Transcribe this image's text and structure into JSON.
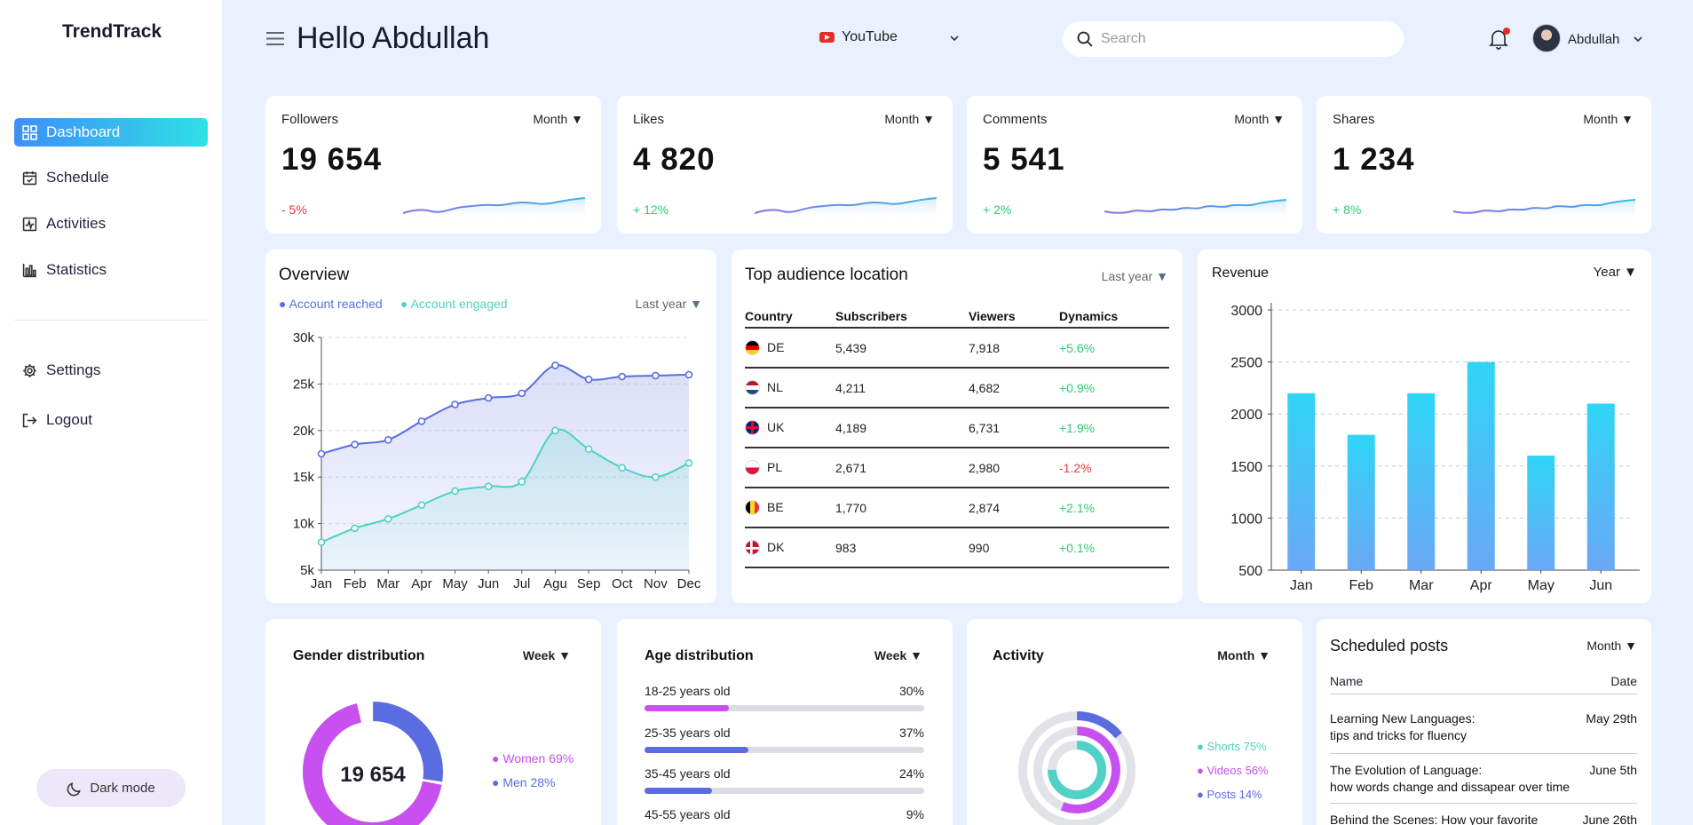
{
  "app": {
    "logo": "TrendTrack"
  },
  "sidebar": {
    "items": [
      {
        "label": "Dashboard",
        "icon": "grid-icon"
      },
      {
        "label": "Schedule",
        "icon": "calendar-icon"
      },
      {
        "label": "Activities",
        "icon": "activity-icon"
      },
      {
        "label": "Statistics",
        "icon": "bar-chart-icon"
      },
      {
        "label": "Settings",
        "icon": "gear-icon"
      },
      {
        "label": "Logout",
        "icon": "logout-icon"
      }
    ],
    "dark_mode_label": "Dark mode"
  },
  "header": {
    "greeting": "Hello Abdullah",
    "platform": "YouTube",
    "search_placeholder": "Search",
    "user_name": "Abdullah"
  },
  "stats": [
    {
      "title": "Followers",
      "period": "Month ▼",
      "value": "19 654",
      "change": "- 5%",
      "change_color": "#e53935"
    },
    {
      "title": "Likes",
      "period": "Month ▼",
      "value": "4 820",
      "change": "+ 12%",
      "change_color": "#2ecc71"
    },
    {
      "title": "Comments",
      "period": "Month ▼",
      "value": "5 541",
      "change": "+ 2%",
      "change_color": "#2ecc71"
    },
    {
      "title": "Shares",
      "period": "Month ▼",
      "value": "1 234",
      "change": "+ 8%",
      "change_color": "#2ecc71"
    }
  ],
  "overview": {
    "title": "Overview",
    "period": "Last year",
    "legend_reached": "● Account reached",
    "legend_engaged": "● Account engaged"
  },
  "location": {
    "title": "Top audience location",
    "period": "Last year",
    "headers": [
      "Country",
      "Subscribers",
      "Viewers",
      "Dynamics"
    ],
    "rows": [
      {
        "code": "DE",
        "subs": "5,439",
        "views": "7,918",
        "dyn": "+5.6%",
        "up": true
      },
      {
        "code": "NL",
        "subs": "4,211",
        "views": "4,682",
        "dyn": "+0.9%",
        "up": true
      },
      {
        "code": "UK",
        "subs": "4,189",
        "views": "6,731",
        "dyn": "+1.9%",
        "up": true
      },
      {
        "code": "PL",
        "subs": "2,671",
        "views": "2,980",
        "dyn": "-1.2%",
        "up": false
      },
      {
        "code": "BE",
        "subs": "1,770",
        "views": "2,874",
        "dyn": "+2.1%",
        "up": true
      },
      {
        "code": "DK",
        "subs": "983",
        "views": "990",
        "dyn": "+0.1%",
        "up": true
      }
    ]
  },
  "revenue": {
    "title": "Revenue",
    "period": "Year ▼"
  },
  "gender": {
    "title": "Gender distribution",
    "period": "Week ▼",
    "center": "19 654",
    "women": "● Women 69%",
    "men": "● Men 28%"
  },
  "age": {
    "title": "Age distribution",
    "period": "Week ▼",
    "rows": [
      {
        "label": "18-25 years old",
        "pct": "30%",
        "value": 30,
        "color": "#c84ff0"
      },
      {
        "label": "25-35 years old",
        "pct": "37%",
        "value": 37,
        "color": "#5a6de0"
      },
      {
        "label": "35-45 years old",
        "pct": "24%",
        "value": 24,
        "color": "#5a6de0"
      },
      {
        "label": "45-55 years old",
        "pct": "9%",
        "value": 9,
        "color": "#5a6de0"
      }
    ]
  },
  "activity": {
    "title": "Activity",
    "period": "Month ▼",
    "shorts": "● Shorts 75%",
    "videos": "● Videos 56%",
    "posts": "● Posts 14%"
  },
  "posts": {
    "title": "Scheduled posts",
    "period": "Month ▼",
    "col_name": "Name",
    "col_date": "Date",
    "items": [
      {
        "line1": "Learning New Languages:",
        "line2": "tips and tricks for fluency",
        "date": "May 29th"
      },
      {
        "line1": "The Evolution of Language:",
        "line2": "how words change and dissapear over time",
        "date": "June 5th"
      },
      {
        "line1": "Behind the Scenes: How your favorite",
        "line2": "",
        "date": "June 26th"
      }
    ]
  },
  "chart_data": [
    {
      "type": "area",
      "title": "Overview",
      "categories": [
        "Jan",
        "Feb",
        "Mar",
        "Apr",
        "May",
        "Jun",
        "Jul",
        "Agu",
        "Sep",
        "Oct",
        "Nov",
        "Dec"
      ],
      "yticks": [
        "5k",
        "10k",
        "15k",
        "20k",
        "25k",
        "30k"
      ],
      "ylim": [
        5000,
        30000
      ],
      "series": [
        {
          "name": "Account reached",
          "color": "#5a6de0",
          "values": [
            17500,
            18500,
            19000,
            21000,
            22800,
            23500,
            24000,
            27000,
            25500,
            25800,
            25900,
            26000
          ]
        },
        {
          "name": "Account engaged",
          "color": "#4fd1c5",
          "values": [
            8000,
            9500,
            10500,
            12000,
            13500,
            14000,
            14500,
            20000,
            18000,
            16000,
            15000,
            16500
          ]
        }
      ]
    },
    {
      "type": "bar",
      "title": "Revenue",
      "categories": [
        "Jan",
        "Feb",
        "Mar",
        "Apr",
        "May",
        "Jun"
      ],
      "values": [
        2200,
        1800,
        2200,
        2500,
        1600,
        2100
      ],
      "yticks": [
        500,
        1000,
        1500,
        2000,
        2500,
        3000
      ],
      "ylim": [
        500,
        3000
      ]
    },
    {
      "type": "pie",
      "title": "Gender distribution",
      "categories": [
        "Women",
        "Men"
      ],
      "values": [
        69,
        28
      ],
      "colors": [
        "#c84ff0",
        "#5a6de0"
      ]
    },
    {
      "type": "pie",
      "title": "Activity",
      "categories": [
        "Shorts",
        "Videos",
        "Posts"
      ],
      "values": [
        75,
        56,
        14
      ],
      "colors": [
        "#4fd1c5",
        "#c84ff0",
        "#5a6de0"
      ]
    }
  ]
}
